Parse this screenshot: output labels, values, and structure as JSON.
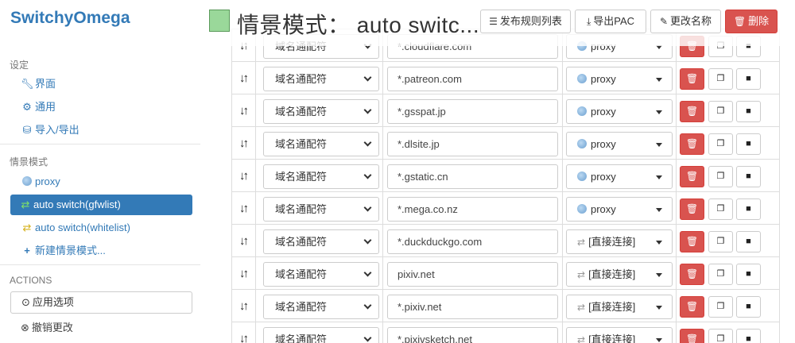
{
  "app": {
    "brand": "SwitchyOmega"
  },
  "sidebar": {
    "settings_header": "设定",
    "settings_items": [
      {
        "label": "界面",
        "icon": "wrench-icon"
      },
      {
        "label": "通用",
        "icon": "gear-icon"
      },
      {
        "label": "导入/导出",
        "icon": "floppy-icon"
      }
    ],
    "profiles_header": "情景模式",
    "profiles": [
      {
        "label": "proxy",
        "icon": "globe-icon"
      },
      {
        "label": "auto switch(gfwlist)",
        "icon": "retweet-icon",
        "active": true
      },
      {
        "label": "auto switch(whitelist)",
        "icon": "retweet-icon"
      },
      {
        "label": "新建情景模式...",
        "icon": "plus-icon"
      }
    ],
    "actions_header": "ACTIONS",
    "apply_label": "应用选项",
    "discard_label": "撤销更改"
  },
  "header": {
    "title": "情景模式： auto switc...",
    "swatch_color": "#9ad89a",
    "publish_label": "发布规则列表",
    "export_label": "导出PAC",
    "rename_label": "更改名称",
    "delete_label": "删除"
  },
  "rules": [
    {
      "type": "域名通配符",
      "pattern": "*.cloudflare.com",
      "profile": "proxy",
      "profile_kind": "proxy"
    },
    {
      "type": "域名通配符",
      "pattern": "*.patreon.com",
      "profile": "proxy",
      "profile_kind": "proxy"
    },
    {
      "type": "域名通配符",
      "pattern": "*.gsspat.jp",
      "profile": "proxy",
      "profile_kind": "proxy"
    },
    {
      "type": "域名通配符",
      "pattern": "*.dlsite.jp",
      "profile": "proxy",
      "profile_kind": "proxy"
    },
    {
      "type": "域名通配符",
      "pattern": "*.gstatic.cn",
      "profile": "proxy",
      "profile_kind": "proxy"
    },
    {
      "type": "域名通配符",
      "pattern": "*.mega.co.nz",
      "profile": "proxy",
      "profile_kind": "proxy"
    },
    {
      "type": "域名通配符",
      "pattern": "*.duckduckgo.com",
      "profile": "[直接连接]",
      "profile_kind": "direct"
    },
    {
      "type": "域名通配符",
      "pattern": "pixiv.net",
      "profile": "[直接连接]",
      "profile_kind": "direct"
    },
    {
      "type": "域名通配符",
      "pattern": "*.pixiv.net",
      "profile": "[直接连接]",
      "profile_kind": "direct"
    },
    {
      "type": "域名通配符",
      "pattern": "*.pixivsketch.net",
      "profile": "[直接连接]",
      "profile_kind": "direct"
    }
  ]
}
